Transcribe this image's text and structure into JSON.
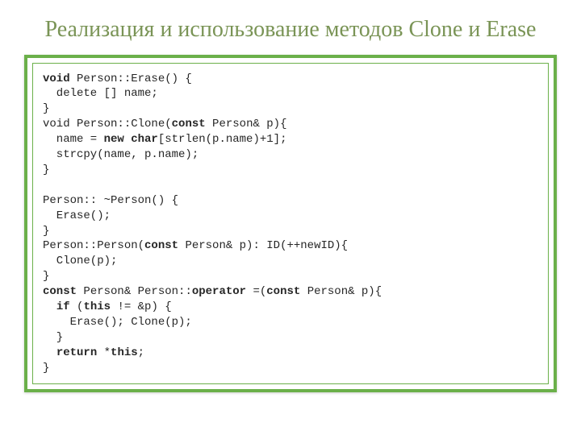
{
  "title": "Реализация и использование методов Clone и Erase",
  "code": {
    "l1a": "void",
    "l1b": " Person::Erase() {",
    "l2": "  delete [] name;",
    "l3": "}",
    "l4a": "void Person::Clone(",
    "l4b": "const",
    "l4c": " Person& p){",
    "l5a": "  name = ",
    "l5b": "new char",
    "l5c": "[strlen(p.name)+1];",
    "l6": "  strcpy(name, p.name);",
    "l7": "}",
    "l8": "",
    "l9": "Person:: ~Person() {",
    "l10": "  Erase();",
    "l11": "}",
    "l12a": "Person::Person(",
    "l12b": "const",
    "l12c": " Person& p): ID(++newID){",
    "l13": "  Clone(p);",
    "l14": "}",
    "l15a": "const",
    "l15b": " Person& Person::",
    "l15c": "operator",
    "l15d": " =(",
    "l15e": "const",
    "l15f": " Person& p){",
    "l16a": "  ",
    "l16b": "if",
    "l16c": " (",
    "l16d": "this",
    "l16e": " != &p) {",
    "l17": "    Erase(); Clone(p);",
    "l18": "  }",
    "l19a": "  ",
    "l19b": "return",
    "l19c": " *",
    "l19d": "this",
    "l19e": ";",
    "l20": "}"
  }
}
